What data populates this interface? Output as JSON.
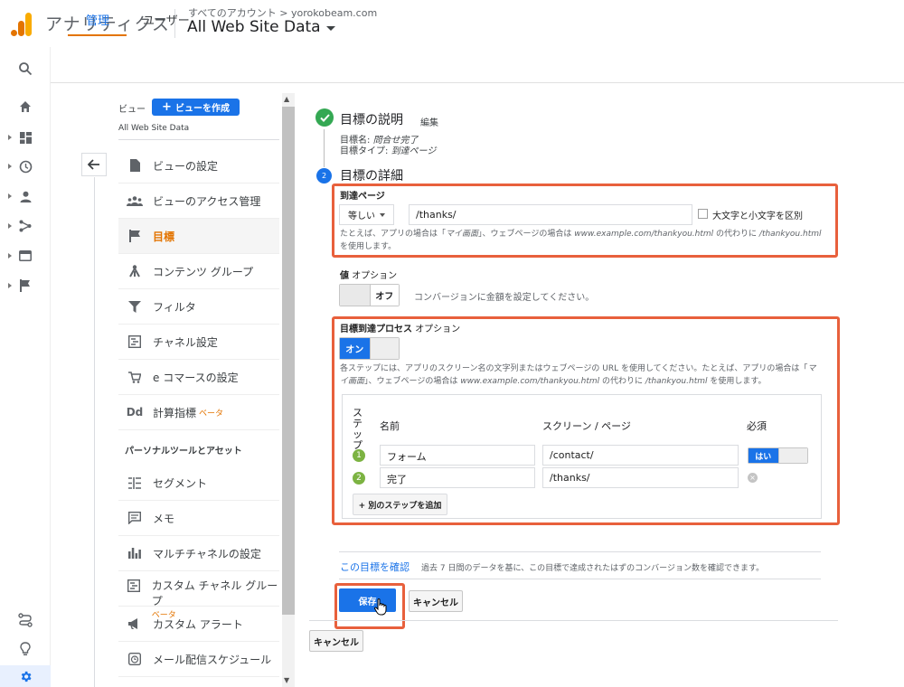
{
  "header": {
    "app_title": "アナリティクス",
    "breadcrumb": "すべてのアカウント > yorokobeam.com",
    "view_name": "All Web Site Data"
  },
  "left_rail": {
    "icons": [
      "search-icon",
      "home-icon",
      "dashboard-icon",
      "clock-icon",
      "person-icon",
      "acquisition-icon",
      "behavior-icon",
      "flag-icon",
      "discover-icon",
      "lightbulb-icon",
      "gear-icon"
    ]
  },
  "tabs": {
    "admin": "管理",
    "user": "ユーザー"
  },
  "sidebar": {
    "column_label": "ビュー",
    "create_view": "ビューを作成",
    "view_name": "All Web Site Data",
    "section_personal": "パーソナルツールとアセット",
    "items": [
      {
        "label": "ビューの設定",
        "icon": "document-icon"
      },
      {
        "label": "ビューのアクセス管理",
        "icon": "people-icon"
      },
      {
        "label": "目標",
        "icon": "flag-icon"
      },
      {
        "label": "コンテンツ グループ",
        "icon": "content-group-icon"
      },
      {
        "label": "フィルタ",
        "icon": "filter-icon"
      },
      {
        "label": "チャネル設定",
        "icon": "channel-icon"
      },
      {
        "label": "e コマースの設定",
        "icon": "cart-icon"
      },
      {
        "label": "計算指標",
        "beta": "ベータ",
        "icon": "dd-icon"
      },
      {
        "label": "セグメント",
        "icon": "segment-icon"
      },
      {
        "label": "メモ",
        "icon": "memo-icon"
      },
      {
        "label": "マルチチャネルの設定",
        "icon": "bar-chart-icon"
      },
      {
        "label": "カスタム チャネル グループ",
        "beta": "ベータ",
        "icon": "channel-icon"
      },
      {
        "label": "カスタム アラート",
        "icon": "megaphone-icon"
      },
      {
        "label": "メール配信スケジュール",
        "icon": "alarm-icon"
      }
    ]
  },
  "goal": {
    "description_heading": "目標の説明",
    "edit": "編集",
    "goal_name_label": "目標名: ",
    "goal_name": "問合せ完了",
    "goal_type_label": "目標タイプ: ",
    "goal_type": "到達ページ",
    "step2_number": "2",
    "details_heading": "目標の詳細",
    "destination": {
      "label": "到達ページ",
      "match_type": "等しい",
      "value": "/thanks/",
      "case_sensitive_label": "大文字と小文字を区別",
      "help_1": "たとえば、アプリの場合は「",
      "help_em_1": "マイ画面",
      "help_2": "」、ウェブページの場合は ",
      "help_em_2": "www.example.com/thankyou.html",
      "help_3": " の代わりに ",
      "help_em_3": "/thankyou.html",
      "help_4": " を使用します。"
    },
    "value": {
      "label": "値",
      "optional": "オプション",
      "toggle_off": "オフ",
      "help": "コンバージョンに金額を設定してください。"
    },
    "funnel": {
      "label": "目標到達プロセス",
      "optional": "オプション",
      "toggle_on": "オン",
      "help_1": "各ステップには、アプリのスクリーン名の文字列またはウェブページの URL を使用してください。たとえば、アプリの場合は「",
      "help_em_1": "マイ画面",
      "help_2": "」、ウェブページの場合は ",
      "help_em_2": "www.example.com/thankyou.html",
      "help_3": " の代わりに ",
      "help_em_3": "/thankyou.html",
      "help_4": " を使用します。",
      "col_step": "ステップ",
      "col_name": "名前",
      "col_screen": "スクリーン / ページ",
      "col_required": "必須",
      "steps": [
        {
          "number": "1",
          "name": "フォーム",
          "screen": "/contact/",
          "required": "はい"
        },
        {
          "number": "2",
          "name": "完了",
          "screen": "/thanks/"
        }
      ],
      "add_step": "+ 別のステップを追加"
    },
    "verify_link": "この目標を確認",
    "verify_help": "過去 7 日間のデータを基に、この目標で達成されたはずのコンバージョン数を確認できます。",
    "save": "保存",
    "cancel": "キャンセル",
    "outer_cancel": "キャンセル"
  },
  "colors": {
    "accent": "#1a73e8",
    "success": "#34a853",
    "highlight": "#e8603c",
    "step": "#7cb342",
    "tab_active_underline": "#e37400"
  }
}
